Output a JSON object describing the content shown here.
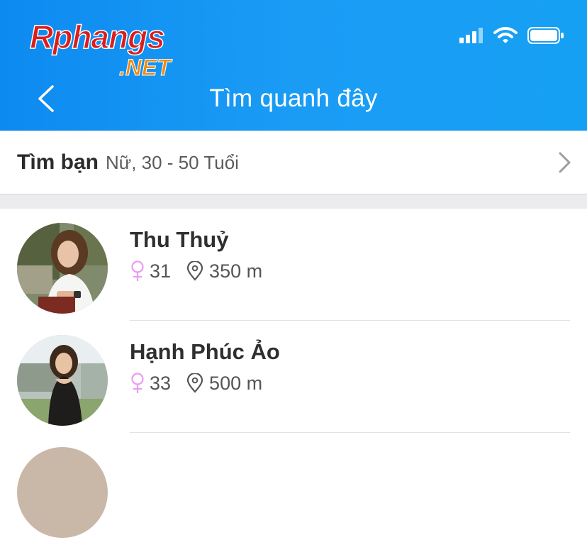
{
  "logo": {
    "text_main": "Rphangs",
    "text_sub": ".NET"
  },
  "header": {
    "title": "Tìm quanh đây",
    "back_icon": "chevron-left-icon"
  },
  "status_bar": {
    "signal_icon": "signal-bars-icon",
    "wifi_icon": "wifi-icon",
    "battery_icon": "battery-icon"
  },
  "filter": {
    "label": "Tìm bạn",
    "criteria": "Nữ, 30 - 50 Tuổi",
    "chevron_icon": "chevron-right-icon"
  },
  "colors": {
    "header_start": "#0d8af0",
    "header_end": "#16a0f4",
    "female_icon": "#e79ef0"
  },
  "users": [
    {
      "name": "Thu Thuỷ",
      "age": "31",
      "distance": "350 m",
      "gender_icon": "female-icon",
      "location_icon": "location-pin-icon"
    },
    {
      "name": "Hạnh Phúc Ảo",
      "age": "33",
      "distance": "500 m",
      "gender_icon": "female-icon",
      "location_icon": "location-pin-icon"
    }
  ]
}
